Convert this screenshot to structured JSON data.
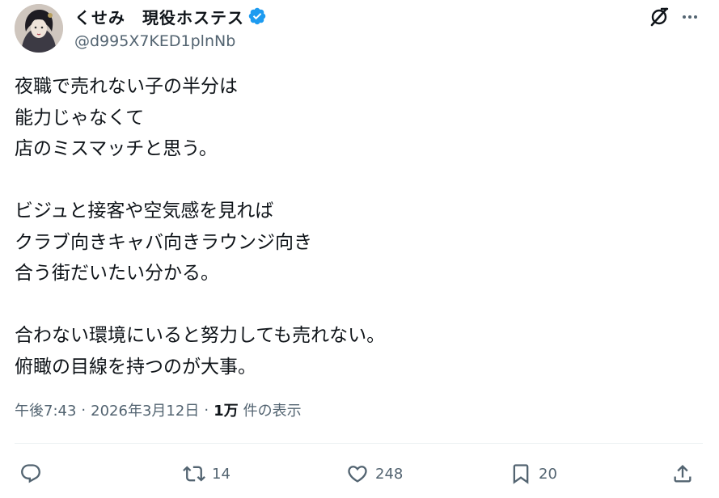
{
  "author": {
    "display_name": "くせみ　現役ホステス",
    "handle": "@d995X7KED1plnNb",
    "verified": true,
    "verified_color": "#1d9bf0",
    "avatar_icon": "avatar-illustration"
  },
  "tweet": {
    "lines": [
      "夜職で売れない子の半分は",
      "能力じゃなくて",
      "店のミスマッチと思う。",
      "",
      "ビジュと接客や空気感を見れば",
      "クラブ向きキャバ向きラウンジ向き",
      "合う街だいたい分かる。",
      "",
      "合わない環境にいると努力しても売れない。",
      "俯瞰の目線を持つのが大事。"
    ]
  },
  "meta": {
    "time": "午後7:43",
    "date": "2026年3月12日",
    "views_count": "1万",
    "views_label": "件の表示",
    "separator": "·"
  },
  "actions": {
    "reply": {
      "icon": "reply-icon",
      "count": ""
    },
    "retweet": {
      "icon": "retweet-icon",
      "count": "14"
    },
    "like": {
      "icon": "heart-icon",
      "count": "248"
    },
    "bookmark": {
      "icon": "bookmark-icon",
      "count": "20"
    },
    "share": {
      "icon": "share-icon",
      "count": ""
    }
  },
  "colors": {
    "text": "#0f1419",
    "secondary": "#536471",
    "divider": "#eff3f4"
  }
}
